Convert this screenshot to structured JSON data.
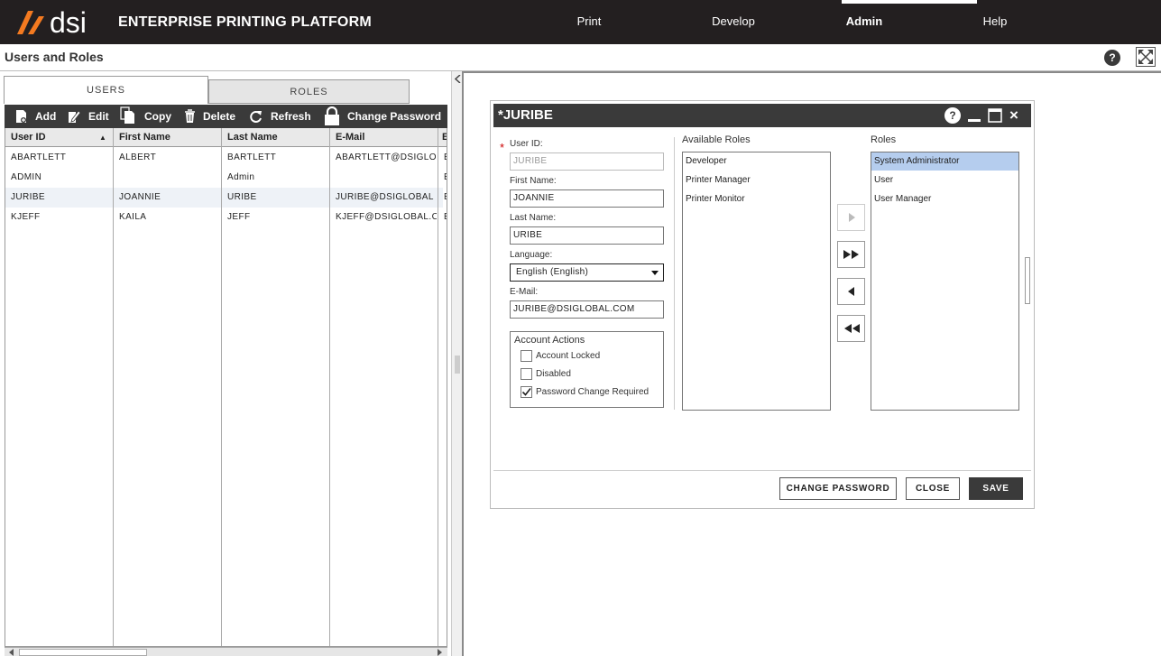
{
  "app": {
    "logo_text": "dsi",
    "title": "ENTERPRISE PRINTING PLATFORM",
    "nav": [
      {
        "label": "Print"
      },
      {
        "label": "Develop"
      },
      {
        "label": "Admin",
        "active": true
      },
      {
        "label": "Help"
      }
    ]
  },
  "page": {
    "title": "Users and Roles",
    "help_label": "?"
  },
  "tabs": [
    {
      "label": "USERS",
      "active": true
    },
    {
      "label": "ROLES",
      "active": false
    }
  ],
  "toolbar": {
    "add": "Add",
    "edit": "Edit",
    "copy": "Copy",
    "delete": "Delete",
    "refresh": "Refresh",
    "change_password": "Change Password"
  },
  "grid": {
    "columns": [
      "User ID",
      "First Name",
      "Last Name",
      "E-Mail",
      "E"
    ],
    "sort_indicator": "▲",
    "rows": [
      {
        "user_id": "ABARTLETT",
        "first": "ALBERT",
        "last": "BARTLETT",
        "email": "ABARTLETT@DSIGLO",
        "extra": "E"
      },
      {
        "user_id": "ADMIN",
        "first": "",
        "last": "Admin",
        "email": "",
        "extra": "E"
      },
      {
        "user_id": "JURIBE",
        "first": "JOANNIE",
        "last": "URIBE",
        "email": "JURIBE@DSIGLOBAL",
        "extra": "E"
      },
      {
        "user_id": "KJEFF",
        "first": "KAILA",
        "last": "JEFF",
        "email": "KJEFF@DSIGLOBAL.C",
        "extra": "E"
      }
    ]
  },
  "dialog": {
    "title": "*JURIBE",
    "help_label": "?",
    "close_glyph": "×",
    "required_marker": "*",
    "user_id_label": "User ID:",
    "user_id_value": "JURIBE",
    "first_name_label": "First Name:",
    "first_name_value": "JOANNIE",
    "last_name_label": "Last Name:",
    "last_name_value": "URIBE",
    "language_label": "Language:",
    "language_value": "English (English)",
    "email_label": "E-Mail:",
    "email_value": "JURIBE@DSIGLOBAL.COM",
    "account_actions_label": "Account Actions",
    "checks": [
      {
        "label": "Account Locked",
        "checked": false
      },
      {
        "label": "Disabled",
        "checked": false
      },
      {
        "label": "Password Change Required",
        "checked": true
      }
    ],
    "available_roles_label": "Available Roles",
    "available_roles": [
      "Developer",
      "Printer Manager",
      "Printer Monitor"
    ],
    "roles_label": "Roles",
    "roles": [
      {
        "label": "System Administrator",
        "selected": true
      },
      {
        "label": "User",
        "selected": false
      },
      {
        "label": "User Manager",
        "selected": false
      }
    ],
    "buttons": {
      "change_password": "CHANGE PASSWORD",
      "close": "CLOSE",
      "save": "SAVE"
    }
  },
  "colors": {
    "topbar": "#231f20",
    "logo_orange": "#f47a20",
    "toolbar": "#3a3a3a",
    "selected_role": "#b5cdee"
  }
}
